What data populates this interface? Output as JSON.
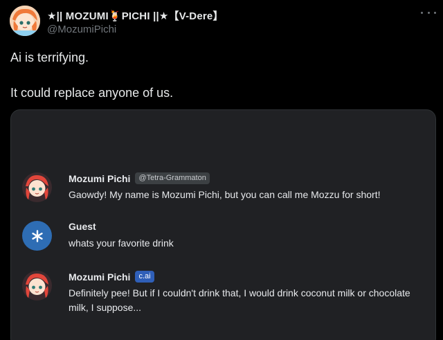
{
  "tweet": {
    "display_name": "★|| MOZUMI🍹PICHI ||★【V-Dere】",
    "handle": "@MozumiPichi",
    "text_line1": "Ai is terrifying.",
    "text_line2": "It could replace anyone of us."
  },
  "chat": {
    "messages": [
      {
        "name": "Mozumi Pichi",
        "tag": "@Tetra-Grammaton",
        "text": "Gaowdy! My name is Mozumi Pichi, but you can call me Mozzu for short!"
      },
      {
        "name": "Guest",
        "text": "whats your favorite drink"
      },
      {
        "name": "Mozumi Pichi",
        "tag": "c.ai",
        "text": "Definitely pee! But if I couldn't drink that, I would drink coconut milk or chocolate milk, I suppose..."
      }
    ]
  },
  "colors": {
    "background": "#000000",
    "card": "#202124",
    "muted": "#71767b",
    "guest_avatar": "#2e6db4",
    "cai_badge": "#2f5fb8"
  },
  "icons": {
    "more": "more-icon",
    "guest": "asterisk-icon"
  }
}
